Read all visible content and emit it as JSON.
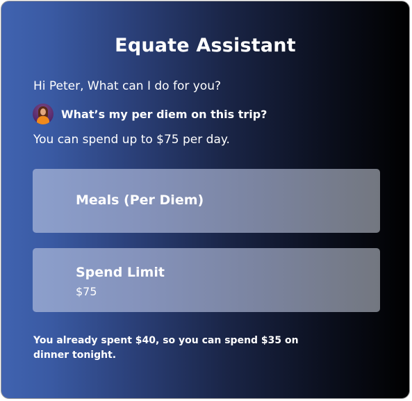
{
  "assistant": {
    "title": "Equate Assistant"
  },
  "chat": {
    "greeting": "Hi Peter, What can I do for you?",
    "user_question": "What’s my per diem on this trip?",
    "answer": "You can spend up to $75 per day."
  },
  "cards": [
    {
      "label": "Meals (Per Diem)"
    },
    {
      "label": "Spend Limit",
      "value": "$75"
    }
  ],
  "footer": {
    "note": "You already spent $40, so you can spend $35 on dinner tonight."
  },
  "colors": {
    "gradient_start": "#4063b0",
    "gradient_end": "#000000",
    "card_start": "#8c9fcc",
    "card_end": "#737780",
    "avatar_shirt": "#f08a1c"
  }
}
